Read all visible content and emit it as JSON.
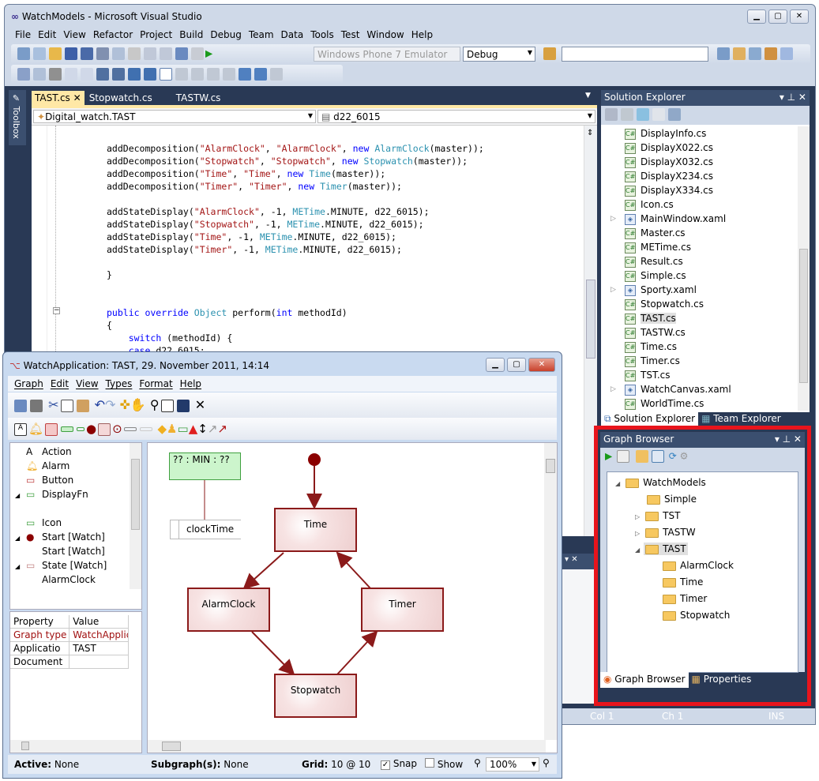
{
  "vs": {
    "title": "WatchModels - Microsoft Visual Studio",
    "menu": [
      "File",
      "Edit",
      "View",
      "Refactor",
      "Project",
      "Build",
      "Debug",
      "Team",
      "Data",
      "Tools",
      "Test",
      "Window",
      "Help"
    ],
    "target_device": "Windows Phone 7 Emulator",
    "config": "Debug",
    "search": "",
    "toolbox_label": "Toolbox",
    "tabs": [
      "TAST.cs",
      "Stopwatch.cs",
      "TASTW.cs"
    ],
    "class_dropdown": "Digital_watch.TAST",
    "member_dropdown": "d22_6015",
    "code": [
      [
        [
          "addDecomposition(",
          ""
        ],
        [
          "\"AlarmClock\"",
          "s"
        ],
        [
          ", ",
          ""
        ],
        [
          "\"AlarmClock\"",
          "s"
        ],
        [
          ", ",
          ""
        ],
        [
          "new",
          "k"
        ],
        [
          " ",
          ""
        ],
        [
          "AlarmClock",
          "t"
        ],
        [
          "(master));",
          ""
        ]
      ],
      [
        [
          "addDecomposition(",
          ""
        ],
        [
          "\"Stopwatch\"",
          "s"
        ],
        [
          ", ",
          ""
        ],
        [
          "\"Stopwatch\"",
          "s"
        ],
        [
          ", ",
          ""
        ],
        [
          "new",
          "k"
        ],
        [
          " ",
          ""
        ],
        [
          "Stopwatch",
          "t"
        ],
        [
          "(master));",
          ""
        ]
      ],
      [
        [
          "addDecomposition(",
          ""
        ],
        [
          "\"Time\"",
          "s"
        ],
        [
          ", ",
          ""
        ],
        [
          "\"Time\"",
          "s"
        ],
        [
          ", ",
          ""
        ],
        [
          "new",
          "k"
        ],
        [
          " ",
          ""
        ],
        [
          "Time",
          "t"
        ],
        [
          "(master));",
          ""
        ]
      ],
      [
        [
          "addDecomposition(",
          ""
        ],
        [
          "\"Timer\"",
          "s"
        ],
        [
          ", ",
          ""
        ],
        [
          "\"Timer\"",
          "s"
        ],
        [
          ", ",
          ""
        ],
        [
          "new",
          "k"
        ],
        [
          " ",
          ""
        ],
        [
          "Timer",
          "t"
        ],
        [
          "(master));",
          ""
        ]
      ],
      [],
      [
        [
          "addStateDisplay(",
          ""
        ],
        [
          "\"AlarmClock\"",
          "s"
        ],
        [
          ", -1, ",
          ""
        ],
        [
          "METime",
          "t"
        ],
        [
          ".MINUTE, d22_6015);",
          ""
        ]
      ],
      [
        [
          "addStateDisplay(",
          ""
        ],
        [
          "\"Stopwatch\"",
          "s"
        ],
        [
          ", -1, ",
          ""
        ],
        [
          "METime",
          "t"
        ],
        [
          ".MINUTE, d22_6015);",
          ""
        ]
      ],
      [
        [
          "addStateDisplay(",
          ""
        ],
        [
          "\"Time\"",
          "s"
        ],
        [
          ", -1, ",
          ""
        ],
        [
          "METime",
          "t"
        ],
        [
          ".MINUTE, d22_6015);",
          ""
        ]
      ],
      [
        [
          "addStateDisplay(",
          ""
        ],
        [
          "\"Timer\"",
          "s"
        ],
        [
          ", -1, ",
          ""
        ],
        [
          "METime",
          "t"
        ],
        [
          ".MINUTE, d22_6015);",
          ""
        ]
      ],
      [],
      [
        [
          "}",
          ""
        ]
      ],
      [],
      [],
      [
        [
          "public override ",
          "k"
        ],
        [
          "Object",
          "t"
        ],
        [
          " perform(",
          ""
        ],
        [
          "int",
          "k"
        ],
        [
          " methodId)",
          ""
        ]
      ],
      [
        [
          "{",
          ""
        ]
      ],
      [
        [
          "    ",
          ""
        ],
        [
          "switch",
          "k"
        ],
        [
          " (methodId) {",
          ""
        ]
      ],
      [
        [
          "    ",
          ""
        ],
        [
          "case",
          "k"
        ],
        [
          " d22_6015:",
          ""
        ]
      ]
    ],
    "solution_explorer": {
      "title": "Solution Explorer",
      "items": [
        {
          "n": "DisplayInfo.cs"
        },
        {
          "n": "DisplayX022.cs"
        },
        {
          "n": "DisplayX032.cs"
        },
        {
          "n": "DisplayX234.cs"
        },
        {
          "n": "DisplayX334.cs"
        },
        {
          "n": "Icon.cs"
        },
        {
          "n": "MainWindow.xaml",
          "x": true
        },
        {
          "n": "Master.cs"
        },
        {
          "n": "METime.cs"
        },
        {
          "n": "Result.cs"
        },
        {
          "n": "Simple.cs"
        },
        {
          "n": "Sporty.xaml",
          "x": true
        },
        {
          "n": "Stopwatch.cs"
        },
        {
          "n": "TAST.cs",
          "sel": true
        },
        {
          "n": "TASTW.cs"
        },
        {
          "n": "Time.cs"
        },
        {
          "n": "Timer.cs"
        },
        {
          "n": "TST.cs"
        },
        {
          "n": "WatchCanvas.xaml",
          "x": true
        },
        {
          "n": "WorldTime.cs"
        }
      ],
      "tabs": [
        "Solution Explorer",
        "Team Explorer"
      ]
    },
    "graph_browser": {
      "title": "Graph Browser",
      "tree": [
        {
          "n": "WatchModels",
          "d": 0,
          "e": "open"
        },
        {
          "n": "Simple",
          "d": 1
        },
        {
          "n": "TST",
          "d": 1,
          "e": "closed"
        },
        {
          "n": "TASTW",
          "d": 1,
          "e": "closed"
        },
        {
          "n": "TAST",
          "d": 1,
          "e": "open",
          "sel": true
        },
        {
          "n": "AlarmClock",
          "d": 2
        },
        {
          "n": "Time",
          "d": 2
        },
        {
          "n": "Timer",
          "d": 2
        },
        {
          "n": "Stopwatch",
          "d": 2
        }
      ],
      "tabs": [
        "Graph Browser",
        "Properties"
      ],
      "highlight_color": "#e8141c"
    },
    "status": {
      "col": "Col 1",
      "ch": "Ch 1",
      "mode": "INS"
    }
  },
  "wa": {
    "title": "WatchApplication: TAST, 29. November 2011, 14:14",
    "menu": [
      "Graph",
      "Edit",
      "View",
      "Types",
      "Format",
      "Help"
    ],
    "types": [
      {
        "n": "Action",
        "e": ""
      },
      {
        "n": "Alarm",
        "e": ""
      },
      {
        "n": "Button",
        "e": ""
      },
      {
        "n": "DisplayFn",
        "e": "open"
      },
      {
        "n": "",
        "e": ""
      },
      {
        "n": "Icon",
        "e": ""
      },
      {
        "n": "Start [Watch]",
        "e": "open"
      },
      {
        "n": "Start [Watch]",
        "e": "",
        "sub": true
      },
      {
        "n": "State [Watch]",
        "e": "open"
      },
      {
        "n": "AlarmClock",
        "e": "",
        "sub": true
      }
    ],
    "props": {
      "headers": [
        "Property",
        "Value"
      ],
      "rows": [
        [
          "Graph type",
          "WatchApplicat"
        ],
        [
          "Applicatio",
          "TAST"
        ],
        [
          "Document",
          ""
        ]
      ]
    },
    "graph": {
      "display_text": "?? :  MIN  : ??",
      "clock_label": "clockTime",
      "nodes": {
        "time": "Time",
        "alarm": "AlarmClock",
        "timer": "Timer",
        "stopwatch": "Stopwatch"
      },
      "edge_color": "#8b1a1a"
    },
    "status": {
      "active_label": "Active:",
      "active": "None",
      "sub_label": "Subgraph(s):",
      "sub": "None",
      "grid_label": "Grid:",
      "grid": "10 @ 10",
      "snap": "Snap",
      "snap_checked": true,
      "show": "Show",
      "show_checked": false,
      "zoom": "100%"
    }
  }
}
